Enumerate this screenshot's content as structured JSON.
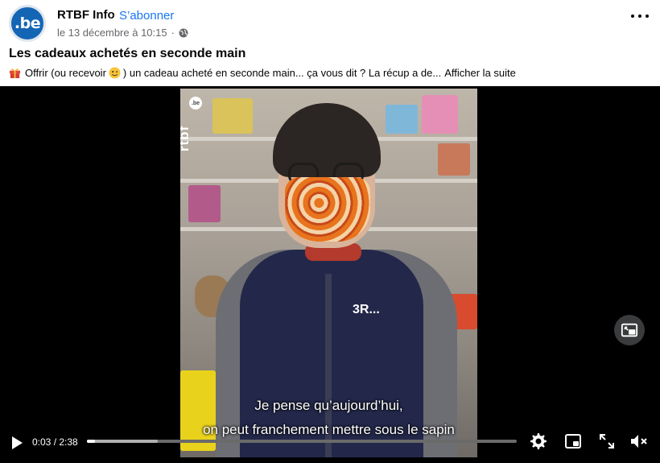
{
  "post": {
    "avatar_text": ".be",
    "page_name": "RTBF Info",
    "separator": "·",
    "follow_label": "S’abonner",
    "date": "le 13 décembre à 10:15",
    "meta_dot": "·",
    "title": "Les cadeaux achetés en seconde main",
    "text_before": "Offrir (ou recevoir",
    "text_after": ") un cadeau acheté en seconde main... ça vous dit ? La récup a de...",
    "see_more": "Afficher la suite"
  },
  "video": {
    "watermark": "rtbf",
    "badge": "3R...",
    "subtitle_line1": "Je pense qu’aujourd’hui,",
    "subtitle_line2": "on peut franchement mettre sous le sapin",
    "current_time": "0:03",
    "duration": "2:38",
    "time_display": "0:03 / 2:38",
    "progress_fraction": 0.019,
    "buffered_fraction": 0.165
  },
  "icons": {
    "more": "more-horizontal-icon",
    "globe": "globe-icon",
    "gift": "gift-emoji-icon",
    "wink": "wink-emoji-icon",
    "play": "play-icon",
    "settings": "gear-icon",
    "pip": "picture-in-picture-icon",
    "fullscreen": "fullscreen-icon",
    "mute": "volume-muted-icon"
  },
  "colors": {
    "link": "#1877f2",
    "avatar_bg": "#1565b5",
    "video_bg": "#000000",
    "progress_played": "#ffffff",
    "progress_track": "#6a6a6a"
  }
}
